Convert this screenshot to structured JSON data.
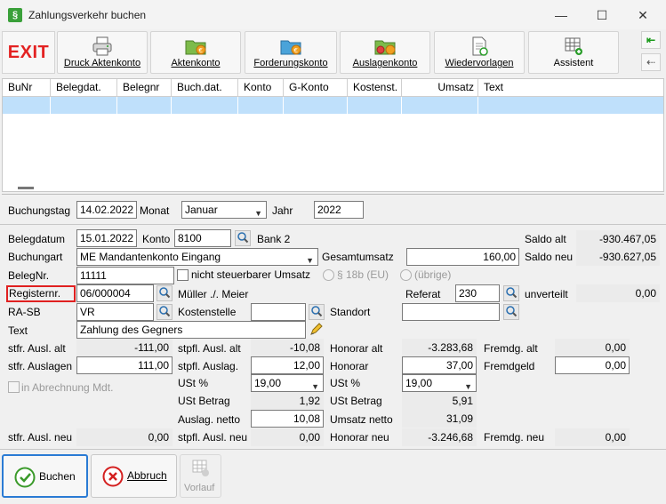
{
  "window": {
    "title": "Zahlungsverkehr buchen",
    "icon": "§",
    "minimize": "—",
    "maximize": "☐",
    "close": "✕"
  },
  "toolbar": {
    "exit": "EXIT",
    "druck": "Druck Aktenkonto",
    "aktenkonto": "Aktenkonto",
    "forderungskonto": "Forderungskonto",
    "auslagenkonto": "Auslagenkonto",
    "wiedervorlagen": "Wiedervorlagen",
    "assistent": "Assistent",
    "nav_first": "⇤",
    "nav_prev": "⇠"
  },
  "grid": {
    "columns": [
      "BuNr",
      "Belegdat.",
      "Belegnr",
      "Buch.dat.",
      "Konto",
      "G-Konto",
      "Kostenst.",
      "Umsatz",
      "Text"
    ]
  },
  "header": {
    "buchungstag_label": "Buchungstag",
    "buchungstag": "14.02.2022",
    "monat_label": "Monat",
    "monat": "Januar",
    "jahr_label": "Jahr",
    "jahr": "2022"
  },
  "form": {
    "belegdatum_label": "Belegdatum",
    "belegdatum": "15.01.2022",
    "konto_label": "Konto",
    "konto": "8100",
    "konto_name": "Bank 2",
    "saldo_alt_label": "Saldo alt",
    "saldo_alt": "-930.467,05",
    "buchungsart_label": "Buchungart",
    "buchungsart": "ME Mandantenkonto Eingang",
    "gesamtumsatz_label": "Gesamtumsatz",
    "gesamtumsatz": "160,00",
    "saldo_neu_label": "Saldo neu",
    "saldo_neu": "-930.627,05",
    "belegnr_label": "BelegNr.",
    "belegnr": "11111",
    "nicht_steuerbar_label": "nicht steuerbarer Umsatz",
    "radio_18b_label": "§ 18b (EU)",
    "radio_uebrige_label": "(übrige)",
    "registernr_label": "Registernr.",
    "registernr": "06/000004",
    "mandant": "Müller ./. Meier",
    "referat_label": "Referat",
    "referat": "230",
    "unverteilt_label": "unverteilt",
    "unverteilt": "0,00",
    "rasb_label": "RA-SB",
    "rasb": "VR",
    "kostenstelle_label": "Kostenstelle",
    "kostenstelle": "",
    "standort_label": "Standort",
    "standort": "",
    "text_label": "Text",
    "text": "Zahlung des Gegners",
    "in_abrechnung_label": "in Abrechnung Mdt."
  },
  "amounts": {
    "stfr_ausl_alt_label": "stfr. Ausl. alt",
    "stfr_ausl_alt": "-111,00",
    "stpfl_ausl_alt_label": "stpfl. Ausl. alt",
    "stpfl_ausl_alt": "-10,08",
    "honorar_alt_label": "Honorar alt",
    "honorar_alt": "-3.283,68",
    "fremdg_alt_label": "Fremdg. alt",
    "fremdg_alt": "0,00",
    "stfr_auslagen_label": "stfr. Auslagen",
    "stfr_auslagen": "111,00",
    "stpfl_auslag_label": "stpfl. Auslag.",
    "stpfl_auslag": "12,00",
    "honorar_label": "Honorar",
    "honorar": "37,00",
    "fremdgeld_label": "Fremdgeld",
    "fremdgeld": "0,00",
    "ust1_label": "USt %",
    "ust1": "19,00",
    "ust2_label": "USt %",
    "ust2": "19,00",
    "ust_betrag1_label": "USt Betrag",
    "ust_betrag1": "1,92",
    "ust_betrag2_label": "USt Betrag",
    "ust_betrag2": "5,91",
    "auslag_netto_label": "Auslag. netto",
    "auslag_netto": "10,08",
    "umsatz_netto_label": "Umsatz netto",
    "umsatz_netto": "31,09",
    "stfr_ausl_neu_label": "stfr. Ausl. neu",
    "stfr_ausl_neu": "0,00",
    "stpfl_ausl_neu_label": "stpfl. Ausl. neu",
    "stpfl_ausl_neu": "0,00",
    "honorar_neu_label": "Honorar neu",
    "honorar_neu": "-3.246,68",
    "fremdg_neu_label": "Fremdg. neu",
    "fremdg_neu": "0,00"
  },
  "buttons": {
    "buchen": "Buchen",
    "abbruch": "Abbruch",
    "vorlauf": "Vorlauf"
  },
  "colors": {
    "exit_red": "#e32222",
    "selected_row": "#bfe0fb",
    "focus_red": "#e02020",
    "buchen_border": "#2a7bd4"
  }
}
